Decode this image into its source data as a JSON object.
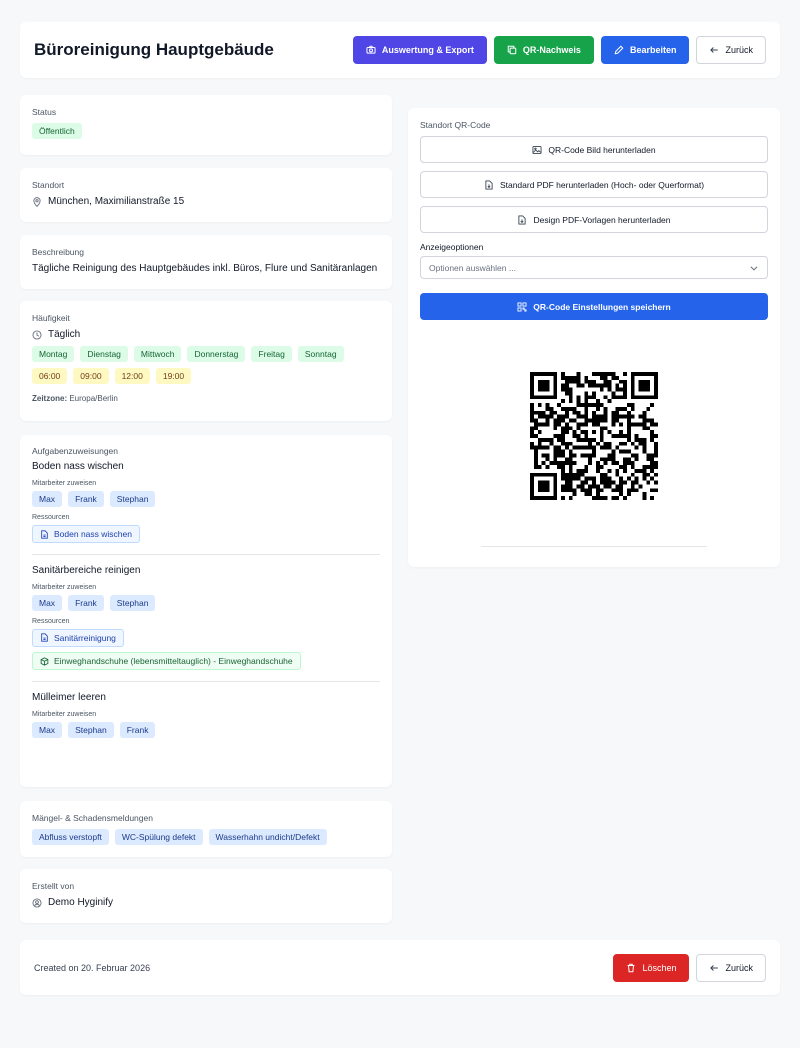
{
  "header": {
    "title": "Büroreinigung Hauptgebäude",
    "export_label": "Auswertung & Export",
    "qr_label": "QR-Nachweis",
    "edit_label": "Bearbeiten",
    "back_label": "Zurück"
  },
  "status": {
    "heading": "Status",
    "value": "Öffentlich"
  },
  "location": {
    "heading": "Standort",
    "value": "München, Maximilianstraße 15"
  },
  "description": {
    "heading": "Beschreibung",
    "value": "Tägliche Reinigung des Hauptgebäudes inkl. Büros, Flure und Sanitäranlagen"
  },
  "frequency": {
    "heading": "Häufigkeit",
    "value": "Täglich",
    "days": [
      "Montag",
      "Dienstag",
      "Mittwoch",
      "Donnerstag",
      "Freitag",
      "Sonntag"
    ],
    "times": [
      "06:00",
      "09:00",
      "12:00",
      "19:00"
    ],
    "timezone_label": "Zeitzone:",
    "timezone": "Europa/Berlin"
  },
  "tasks": {
    "heading": "Aufgabenzuweisungen",
    "employees_label": "Mitarbeiter zuweisen",
    "resources_label": "Ressourcen",
    "items": [
      {
        "title": "Boden nass wischen",
        "employees": [
          "Max",
          "Frank",
          "Stephan"
        ],
        "resource_doc": "Boden nass wischen"
      },
      {
        "title": "Sanitärbereiche reinigen",
        "employees": [
          "Max",
          "Frank",
          "Stephan"
        ],
        "resource_doc": "Sanitärreinigung",
        "resource_item": "Einweghandschuhe (lebensmitteltauglich) - Einweghandschuhe"
      },
      {
        "title": "Mülleimer leeren",
        "employees": [
          "Max",
          "Stephan",
          "Frank"
        ]
      }
    ]
  },
  "defects": {
    "heading": "Mängel- & Schadensmeldungen",
    "items": [
      "Abfluss verstopft",
      "WC-Spülung defekt",
      "Wasserhahn undicht/Defekt"
    ]
  },
  "creator": {
    "heading": "Erstellt von",
    "value": "Demo Hyginify"
  },
  "qr": {
    "heading": "Standort QR-Code",
    "download_image": "QR-Code Bild herunterladen",
    "download_pdf": "Standard PDF herunterladen (Hoch- oder Querformat)",
    "design_pdf": "Design PDF-Vorlagen herunterladen",
    "options_label": "Anzeigeoptionen",
    "options_placeholder": "Optionen auswählen ...",
    "save_label": "QR-Code Einstellungen speichern"
  },
  "footer": {
    "created": "Created on 20. Februar 2026",
    "delete_label": "Löschen",
    "back_label": "Zurück"
  },
  "colors": {
    "primary": "#2563eb",
    "purple": "#4f46e5",
    "green": "#16a34a",
    "red": "#dc2626"
  }
}
